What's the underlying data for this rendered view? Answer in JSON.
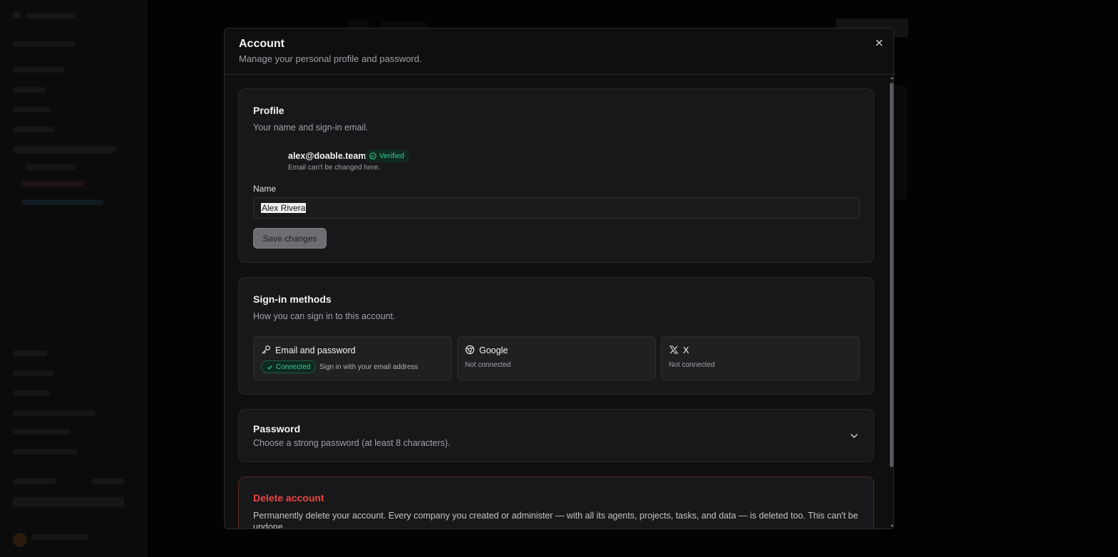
{
  "dialog": {
    "title": "Account",
    "subtitle": "Manage your personal profile and password."
  },
  "profile": {
    "title": "Profile",
    "subtitle": "Your name and sign-in email.",
    "email": "alex@doable.team",
    "verified_label": "Verified",
    "email_note": "Email can't be changed here.",
    "name_label": "Name",
    "name_value": "Alex Rivera",
    "save_label": "Save changes"
  },
  "signin": {
    "title": "Sign-in methods",
    "subtitle": "How you can sign in to this account.",
    "methods": [
      {
        "label": "Email and password",
        "icon": "key-icon",
        "status": "Connected",
        "note": "Sign in with your email address"
      },
      {
        "label": "Google",
        "icon": "google-icon",
        "status": "Not connected"
      },
      {
        "label": "X",
        "icon": "x-logo-icon",
        "status": "Not connected"
      }
    ]
  },
  "password": {
    "title": "Password",
    "subtitle": "Choose a strong password (at least 8 characters)."
  },
  "delete": {
    "title": "Delete account",
    "text": "Permanently delete your account. Every company you created or administer — with all its agents, projects, tasks, and data — is deleted too. This can't be undone."
  },
  "colors": {
    "accent_green": "#34d399",
    "danger_red": "#ef4444"
  }
}
